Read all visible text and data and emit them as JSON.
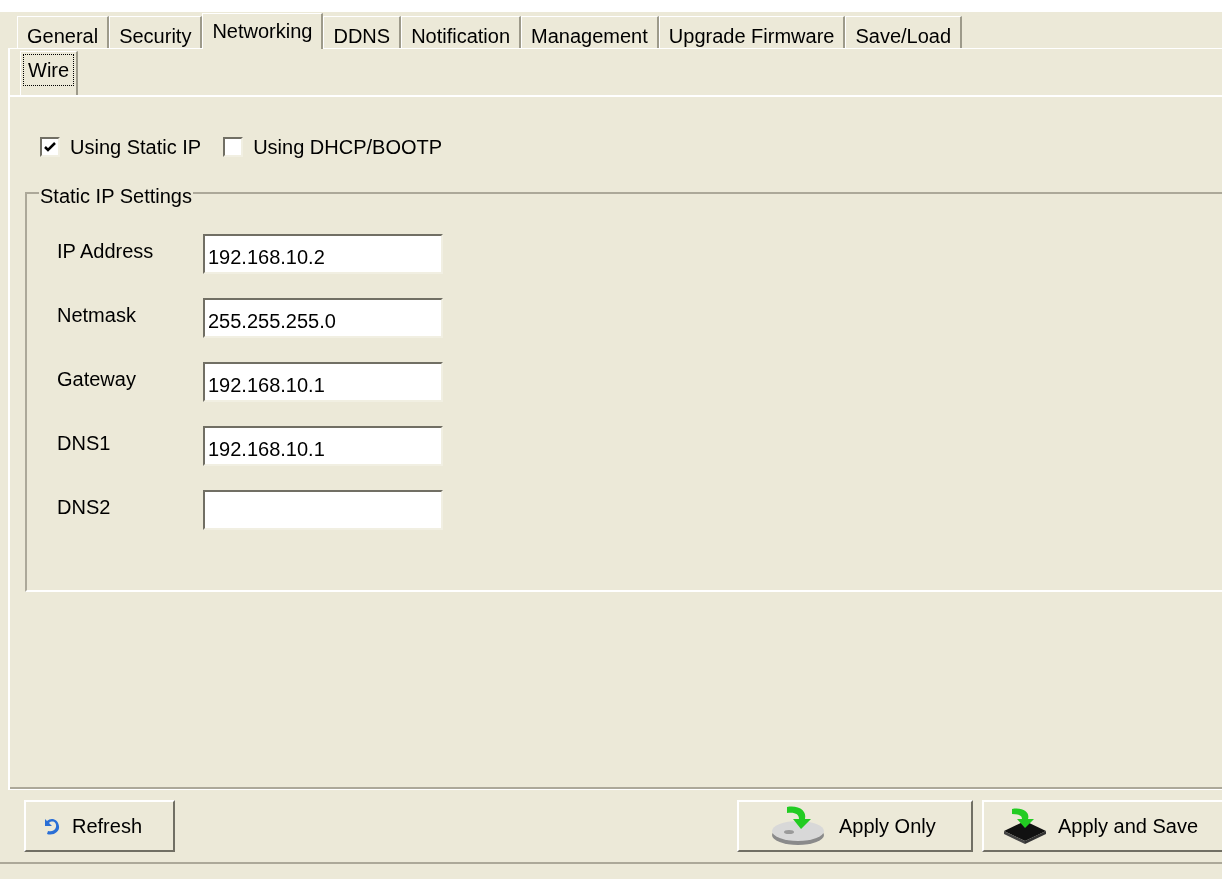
{
  "tabs": [
    {
      "label": "General",
      "selected": false
    },
    {
      "label": "Security",
      "selected": false
    },
    {
      "label": "Networking",
      "selected": true
    },
    {
      "label": "DDNS",
      "selected": false
    },
    {
      "label": "Notification",
      "selected": false
    },
    {
      "label": "Management",
      "selected": false
    },
    {
      "label": "Upgrade Firmware",
      "selected": false
    },
    {
      "label": "Save/Load",
      "selected": false
    }
  ],
  "subtabs": [
    {
      "label": "Wire",
      "selected": true
    }
  ],
  "options": [
    {
      "label": "Using Static IP",
      "checked": true
    },
    {
      "label": "Using DHCP/BOOTP",
      "checked": false
    }
  ],
  "static_ip_group": {
    "title": "Static IP Settings",
    "fields": [
      {
        "label": "IP Address",
        "value": "192.168.10.2"
      },
      {
        "label": "Netmask",
        "value": "255.255.255.0"
      },
      {
        "label": "Gateway",
        "value": "192.168.10.1"
      },
      {
        "label": "DNS1",
        "value": "192.168.10.1"
      },
      {
        "label": "DNS2"
      }
    ]
  },
  "buttons": [
    {
      "label": "Refresh",
      "kind": "refresh"
    },
    {
      "label": "Apply Only",
      "kind": "apply"
    },
    {
      "label": "Apply and Save",
      "kind": "save"
    }
  ]
}
